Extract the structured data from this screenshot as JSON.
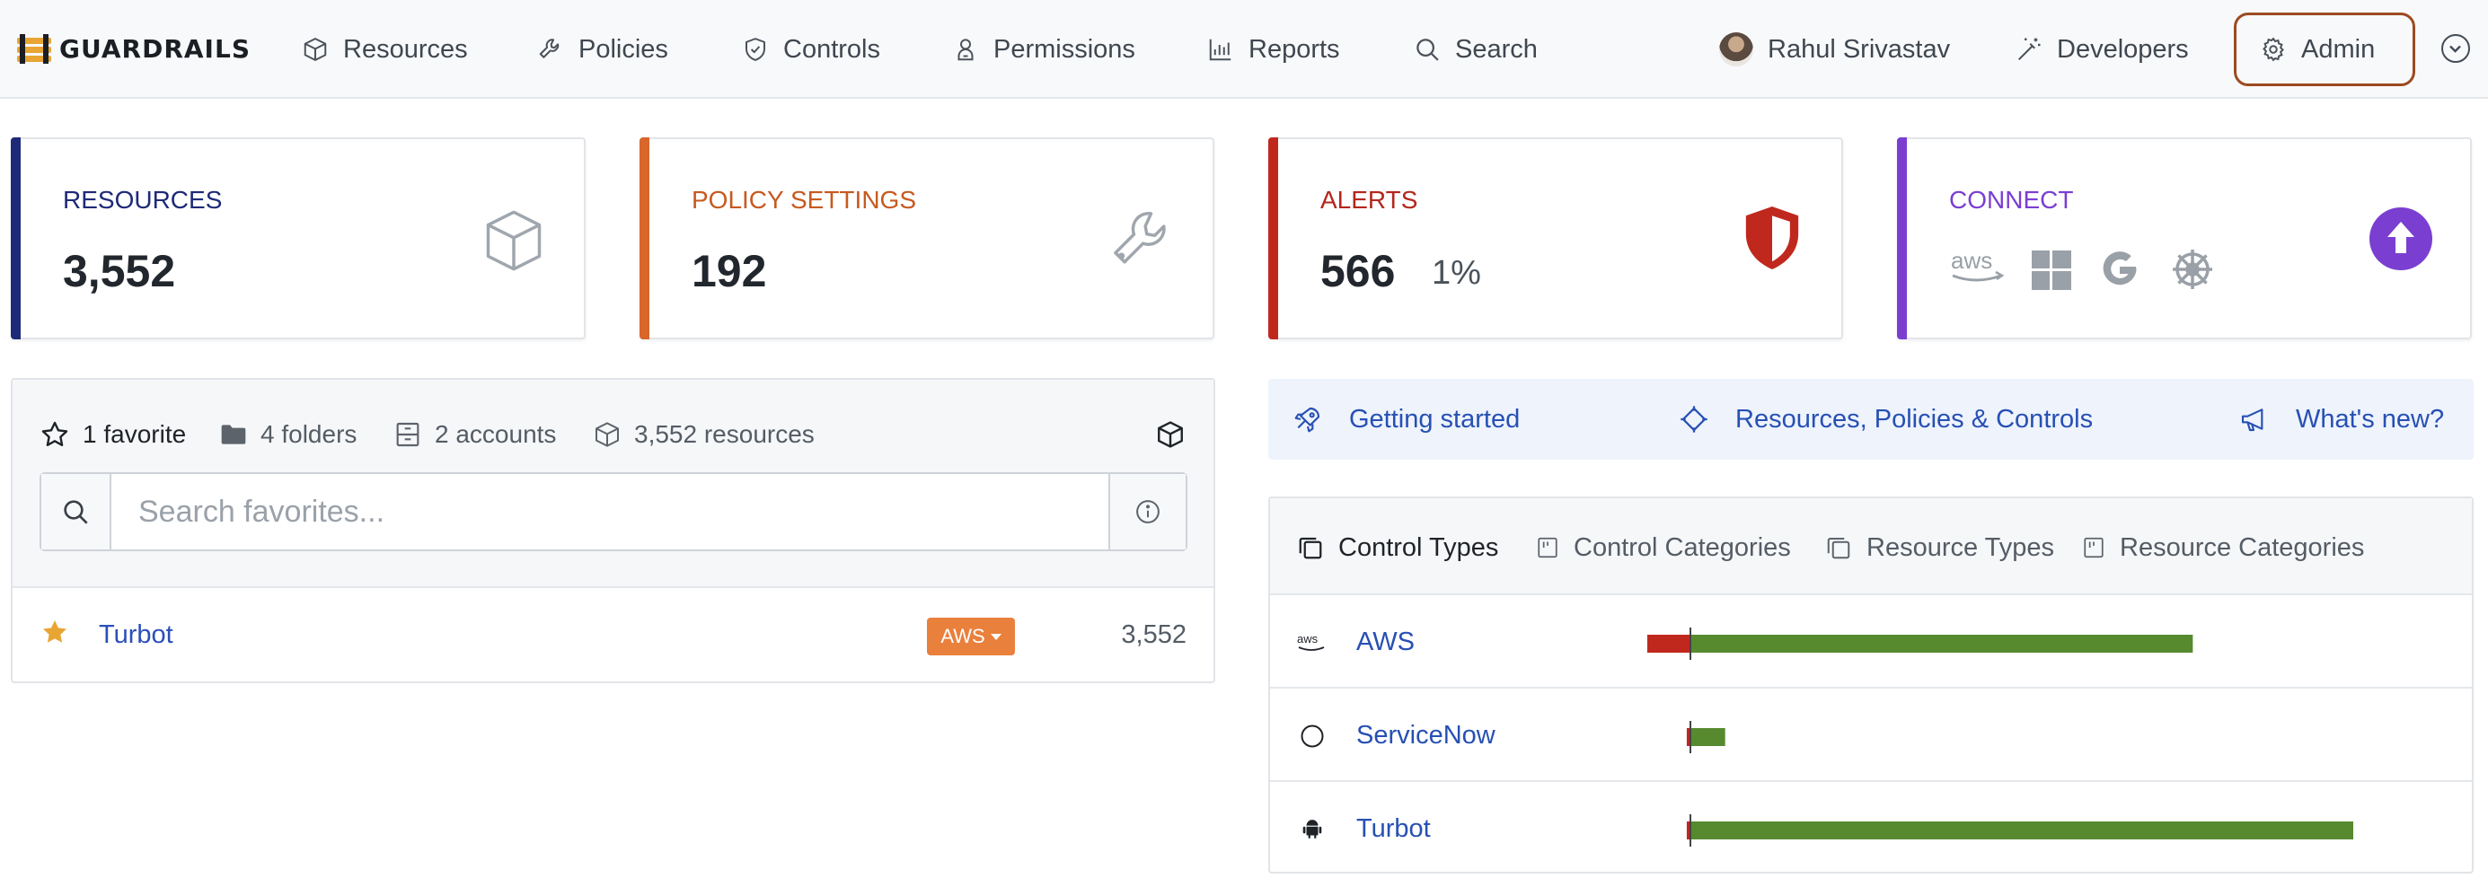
{
  "nav": {
    "brand": "GUARDRAILS",
    "items": [
      {
        "label": "Resources",
        "icon": "cube-icon"
      },
      {
        "label": "Policies",
        "icon": "wrench-icon"
      },
      {
        "label": "Controls",
        "icon": "shield-check-icon"
      },
      {
        "label": "Permissions",
        "icon": "user-icon"
      },
      {
        "label": "Reports",
        "icon": "bar-chart-icon"
      },
      {
        "label": "Search",
        "icon": "search-icon"
      }
    ],
    "user": "Rahul Srivastav",
    "developers": "Developers",
    "admin": "Admin"
  },
  "cards": {
    "resources": {
      "label": "RESOURCES",
      "value": "3,552",
      "color": "#1e2a78"
    },
    "policy_settings": {
      "label": "POLICY SETTINGS",
      "value": "192",
      "color": "#d9662b"
    },
    "alerts": {
      "label": "ALERTS",
      "value": "566",
      "pct": "1%",
      "color": "#c0281e"
    },
    "connect": {
      "label": "CONNECT",
      "color": "#7a3fd1"
    }
  },
  "favorites": {
    "stats": {
      "favorites": "1 favorite",
      "folders": "4 folders",
      "accounts": "2 accounts",
      "resources": "3,552 resources"
    },
    "search_placeholder": "Search favorites...",
    "rows": [
      {
        "name": "Turbot",
        "badge": "AWS",
        "count": "3,552"
      }
    ]
  },
  "links": {
    "getting_started": "Getting started",
    "rpc": "Resources, Policies & Controls",
    "whats_new": "What's new?"
  },
  "control_panel": {
    "tabs": [
      "Control Types",
      "Control Categories",
      "Resource Types",
      "Resource Categories"
    ],
    "active_tab": "Control Types",
    "rows": [
      {
        "name": "AWS",
        "icon": "aws-icon",
        "alarm": 0.0695,
        "ok": 0.6215
      },
      {
        "name": "ServiceNow",
        "icon": "circle-icon",
        "alarm": 0.0045,
        "ok": 0.043
      },
      {
        "name": "Turbot",
        "icon": "android-icon",
        "alarm": 0.0045,
        "ok": 0.82
      }
    ],
    "colors": {
      "alarm": "#c0281e",
      "ok": "#578a2f"
    }
  }
}
